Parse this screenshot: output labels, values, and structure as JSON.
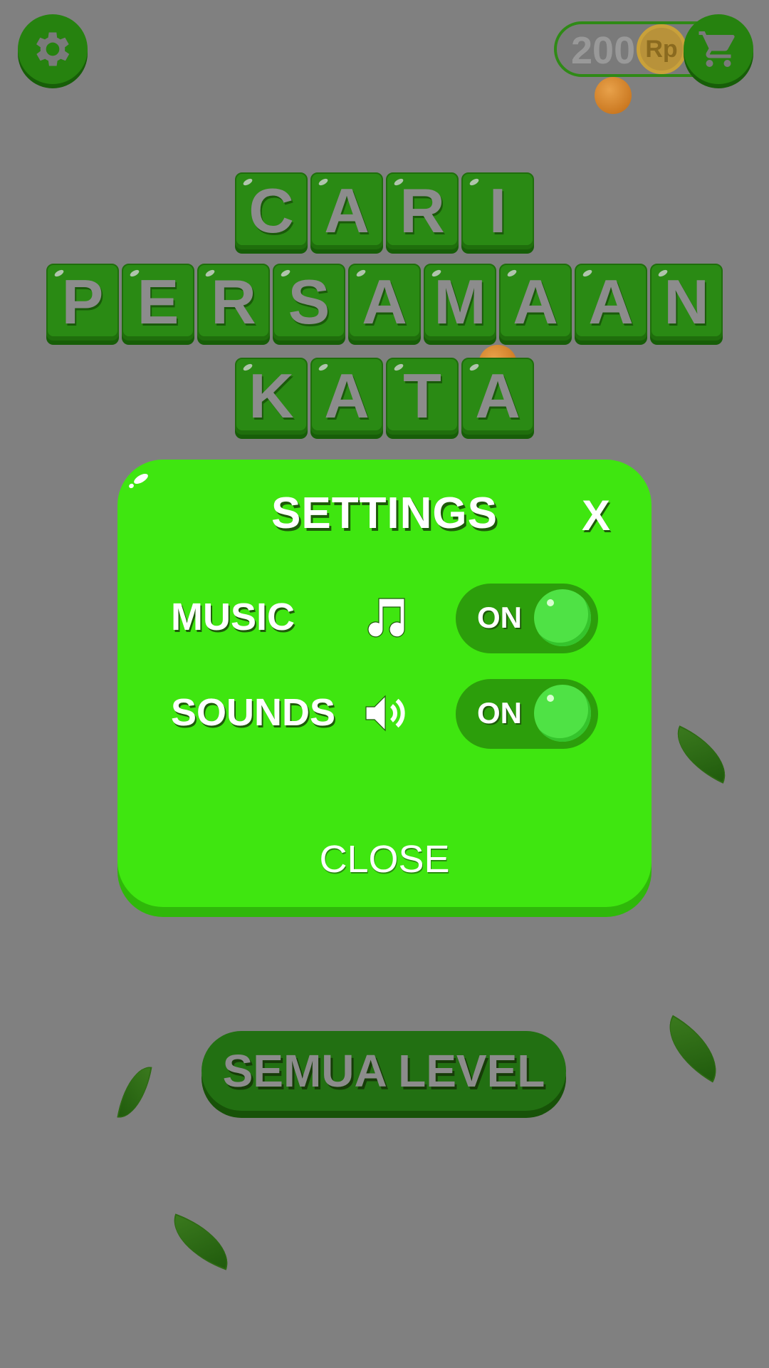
{
  "header": {
    "settings_icon": "gear-icon",
    "coins": "200",
    "currency_symbol": "Rp",
    "shop_icon": "cart-icon"
  },
  "title": {
    "lines": [
      "CARI",
      "PERSAMAAN",
      "KATA"
    ]
  },
  "settings_dialog": {
    "title": "SETTINGS",
    "close_x": "X",
    "music_label": "MUSIC",
    "music_icon": "music-note-icon",
    "music_state": "ON",
    "sounds_label": "SOUNDS",
    "sounds_icon": "speaker-icon",
    "sounds_state": "ON",
    "close_label": "CLOSE"
  },
  "main": {
    "all_levels_label": "SEMUA LEVEL"
  },
  "colors": {
    "background": "#808080",
    "panel": "#3fe610",
    "tile": "#2a8a14",
    "button_dark": "#227012"
  }
}
